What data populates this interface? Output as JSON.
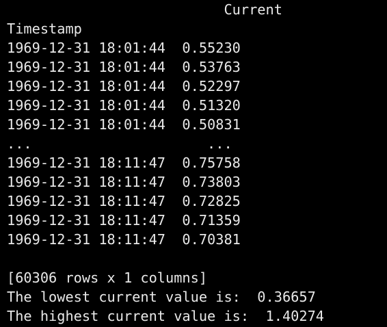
{
  "theme": {
    "background": "#000000",
    "foreground": "#e8e8e8"
  },
  "output": {
    "column_header": "                          Current",
    "index_name": "Timestamp",
    "rows_head": [
      "1969-12-31 18:01:44  0.55230",
      "1969-12-31 18:01:44  0.53763",
      "1969-12-31 18:01:44  0.52297",
      "1969-12-31 18:01:44  0.51320",
      "1969-12-31 18:01:44  0.50831"
    ],
    "ellipsis": "...                     ...",
    "rows_tail": [
      "1969-12-31 18:11:47  0.75758",
      "1969-12-31 18:11:47  0.73803",
      "1969-12-31 18:11:47  0.72825",
      "1969-12-31 18:11:47  0.71359",
      "1969-12-31 18:11:47  0.70381"
    ],
    "shape": "[60306 rows x 1 columns]",
    "lowest_line": "The lowest current value is:  0.36657",
    "highest_line": "The highest current value is:  1.40274"
  }
}
